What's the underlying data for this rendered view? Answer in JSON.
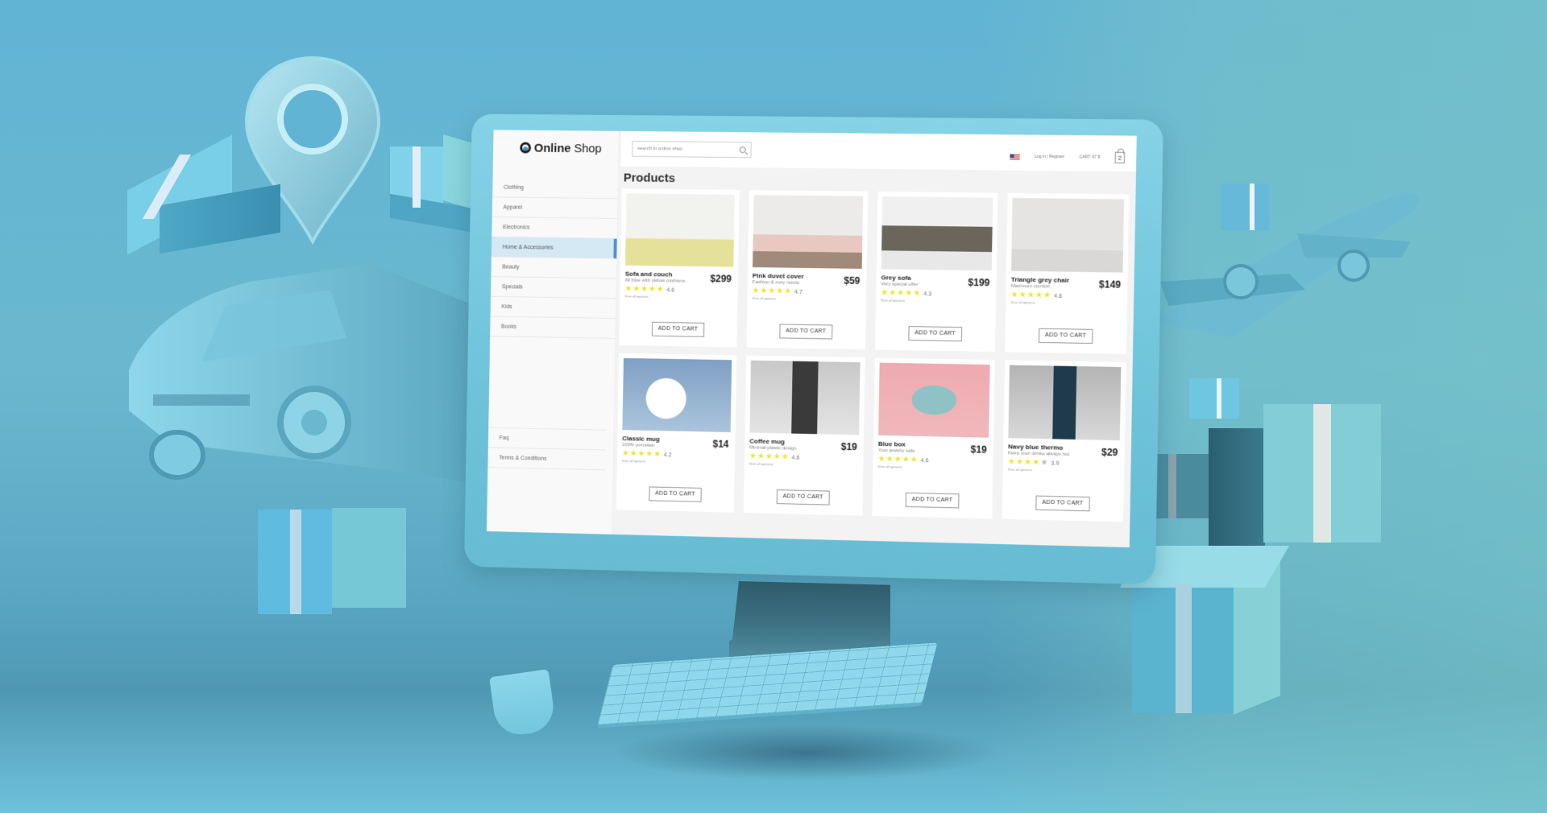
{
  "scene": {
    "background_color": "#62b4d4",
    "decorations": [
      "location-pin",
      "delivery-van",
      "airplane",
      "parcel-boxes",
      "keyboard",
      "mouse"
    ]
  },
  "app": {
    "logo_bold": "Online",
    "logo_light": "Shop"
  },
  "header": {
    "search_placeholder": "search in online shop",
    "language_flag": "us-flag",
    "login_label": "Log in",
    "separator": "|",
    "register_label": "Register",
    "cart_label": "CART: 67 $",
    "cart_count": "2"
  },
  "sidebar": {
    "items": [
      {
        "label": "Clothing",
        "active": false
      },
      {
        "label": "Apparel",
        "active": false
      },
      {
        "label": "Electronics",
        "active": false
      },
      {
        "label": "Home & Accessories",
        "active": true
      },
      {
        "label": "Beauty",
        "active": false
      },
      {
        "label": "Specials",
        "active": false
      },
      {
        "label": "Kids",
        "active": false
      },
      {
        "label": "Books",
        "active": false
      }
    ],
    "footer_items": [
      {
        "label": "Faq"
      },
      {
        "label": "Terms & Conditions"
      }
    ]
  },
  "main": {
    "title": "Products",
    "opinions_label": "View all opinions",
    "add_to_cart_label": "ADD TO CART",
    "products": [
      {
        "name": "Sofa and couch",
        "desc": "All blue with yellow cushions",
        "price": "$299",
        "rating": "4.6",
        "stars": 4.5,
        "image": "blue-sofa"
      },
      {
        "name": "Pink duvet cover",
        "desc": "Fashion & cozy nordic",
        "price": "$59",
        "rating": "4.7",
        "stars": 4.5,
        "image": "pink-bed"
      },
      {
        "name": "Grey sofa",
        "desc": "Very special offer",
        "price": "$199",
        "rating": "4.3",
        "stars": 4.5,
        "image": "grey-sofa"
      },
      {
        "name": "Triangle grey chair",
        "desc": "Maximum comfort",
        "price": "$149",
        "rating": "4.6",
        "stars": 4.5,
        "image": "triangle-chair"
      },
      {
        "name": "Classic mug",
        "desc": "100% porcelain",
        "price": "$14",
        "rating": "4.2",
        "stars": 4.5,
        "image": "white-mug"
      },
      {
        "name": "Coffee mug",
        "desc": "Minimal plastic design",
        "price": "$19",
        "rating": "4.8",
        "stars": 5,
        "image": "coffee-cup"
      },
      {
        "name": "Blue box",
        "desc": "Your jewelry safe",
        "price": "$19",
        "rating": "4.6",
        "stars": 4.5,
        "image": "blue-box"
      },
      {
        "name": "Navy blue thermo",
        "desc": "Keep your drinks always hot",
        "price": "$29",
        "rating": "3.9",
        "stars": 4,
        "image": "navy-thermo"
      }
    ]
  }
}
